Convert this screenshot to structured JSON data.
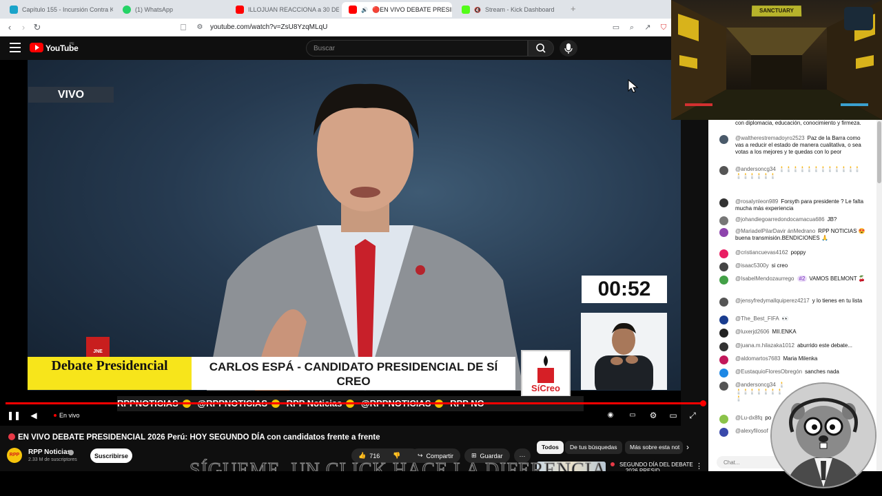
{
  "browser": {
    "tabs": [
      {
        "label": "Capítulo 155 - Incursión Contra Krep",
        "favicon_color": "#19a3c9"
      },
      {
        "label": "(1) WhatsApp",
        "favicon_color": "#25d366"
      },
      {
        "label": "ILLOJUAN REACCIONA a 30 DETALLES",
        "favicon_color": "#ff0000"
      },
      {
        "label": "🔴EN VIVO DEBATE PRESIDE",
        "favicon_color": "#ff0000",
        "active": true
      },
      {
        "label": "Stream - Kick Dashboard",
        "favicon_color": "#53fc18"
      }
    ],
    "new_tab": "+",
    "url": "youtube.com/watch?v=ZsU8YzqMLqU"
  },
  "youtube": {
    "logo_text": "YouTube",
    "country_code": "PE",
    "search_placeholder": "Buscar"
  },
  "video": {
    "live_overlay": "VIVO",
    "timer": "00:52",
    "lower_third_left": "Debate Presidencial",
    "lower_third_main": "CARLOS ESPÁ - CANDIDATO PRESIDENCIAL DE SÍ CREO",
    "party_logo_text": "SíCreo",
    "jne_text": "JNE",
    "ticker": [
      "RPPNOTICIAS",
      "@RPPNOTICIAS",
      "RPP Noticias",
      "@RPPNOTICIAS",
      "RPP NO"
    ],
    "progress": 1.0,
    "status": "En vivo"
  },
  "below": {
    "title": "EN VIVO DEBATE PRESIDENCIAL 2026 Perú: HOY SEGUNDO DÍA con candidatos frente a frente",
    "channel": "RPP Noticias",
    "channel_avatar": "RPP",
    "subscribers": "2.33 M de suscriptores",
    "subscribe": "Suscribirse",
    "likes": "716",
    "share": "Compartir",
    "save": "Guardar",
    "more": "···",
    "chips": [
      "Todos",
      "De tus búsquedas",
      "Más sobre esta not"
    ],
    "rec_title": "SEGUNDO DÍA DEL DEBATE ... 2026 PRESID...",
    "subtitle_overlay": "SÍGUEME, UN CLICK HACE LA DIFERENCIA"
  },
  "stream": {
    "game_sign": "SANCTUARY"
  },
  "chat": {
    "messages": [
      {
        "author": "",
        "text": "con diplomacia, educación, conocimiento y firmeza.",
        "color": ""
      },
      {
        "author": "@waltherestremadoyro2523",
        "text": "Paz de la Barra como vas a reducir el estado de manera cualitativa, o sea votas a los mejores y te quedas con lo peor",
        "color": "#4a5a6a"
      },
      {
        "author": "@andersoncg34",
        "text": "🕯️🕯️🕯️🕯️🕯️🕯️🕯️🕯️🕯️🕯️🕯️🕯️🕯️🕯️🕯️🕯️🕯️🕯️",
        "color": "#555555"
      },
      {
        "author": "@rosalynleon989",
        "text": "Forsyth para presidente ? Le falta mucha más experiencia",
        "color": "#333333"
      },
      {
        "author": "@johandiegoarredondocamacua686",
        "text": "JB?",
        "color": "#777777"
      },
      {
        "author": "@MariadelPilarDavir ánMedrano",
        "text": "RPP NOTICIAS 😍buena transmisión.BENDICIONES 🙏",
        "color": "#8e44ad"
      },
      {
        "author": "@cristiancuevas4162",
        "text": "poppy",
        "color": "#e91e63"
      },
      {
        "author": "@isaac5300y",
        "text": "si creo",
        "color": "#444444"
      },
      {
        "author": "@IsabelMendozaurrego",
        "badge": "#2",
        "text": "VAMOS BELMONT 🍒",
        "color": "#43a047"
      },
      {
        "author": "@jensyfredymallquiperez4217",
        "text": "y lo tienes en tu lista",
        "color": "#555555"
      },
      {
        "author": "@The_Best_FIFA",
        "text": "👀",
        "color": "#1a3d8f"
      },
      {
        "author": "@luxerjd2606",
        "text": "MII.ENKA",
        "color": "#222222"
      },
      {
        "author": "@juana.m.hilazaka1012",
        "text": "aburrido este debate...",
        "color": "#333333"
      },
      {
        "author": "@aldomartos7683",
        "text": "Maria Milenka",
        "color": "#c2185b"
      },
      {
        "author": "@EustaquioFloresObregón",
        "text": "sanches nada",
        "color": "#1e88e5"
      },
      {
        "author": "@andersoncg34",
        "text": "🕯️🕯️🕯️🕯️🕯️🕯️🕯️🕯️🕯️",
        "color": "#555555"
      },
      {
        "author": "@Lu-dx8fq",
        "text": "po",
        "color": "#8bc34a"
      },
      {
        "author": "@alexyfilosof",
        "text": "🕯️🕯️",
        "color": "#3949ab"
      }
    ],
    "input_placeholder": "Chat..."
  }
}
